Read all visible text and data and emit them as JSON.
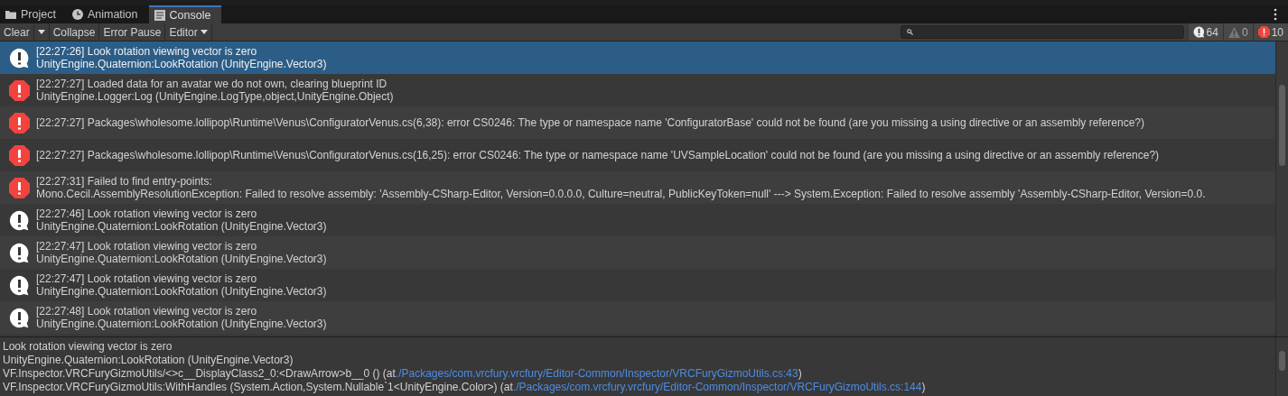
{
  "tabs": [
    {
      "label": "Project",
      "selected": false
    },
    {
      "label": "Animation",
      "selected": false
    },
    {
      "label": "Console",
      "selected": true
    }
  ],
  "toolbar": {
    "clear": "Clear",
    "collapse": "Collapse",
    "error_pause": "Error Pause",
    "editor": "Editor"
  },
  "counts": [
    {
      "kind": "log",
      "count": "64"
    },
    {
      "kind": "warning",
      "count": "0"
    },
    {
      "kind": "error",
      "count": "10"
    }
  ],
  "entries": [
    {
      "kind": "log",
      "selected": true,
      "lines": [
        "[22:27:26] Look rotation viewing vector is zero",
        "UnityEngine.Quaternion:LookRotation (UnityEngine.Vector3)"
      ]
    },
    {
      "kind": "error",
      "selected": false,
      "lines": [
        "[22:27:27] Loaded data for an avatar we do not own, clearing blueprint ID",
        "UnityEngine.Logger:Log (UnityEngine.LogType,object,UnityEngine.Object)"
      ]
    },
    {
      "kind": "error",
      "selected": false,
      "lines": [
        "[22:27:27] Packages\\wholesome.lollipop\\Runtime\\Venus\\ConfiguratorVenus.cs(6,38): error CS0246: The type or namespace name 'ConfiguratorBase' could not be found (are you missing a using directive or an assembly reference?)"
      ]
    },
    {
      "kind": "error",
      "selected": false,
      "lines": [
        "[22:27:27] Packages\\wholesome.lollipop\\Runtime\\Venus\\ConfiguratorVenus.cs(16,25): error CS0246: The type or namespace name 'UVSampleLocation' could not be found (are you missing a using directive or an assembly reference?)"
      ]
    },
    {
      "kind": "error",
      "selected": false,
      "lines": [
        "[22:27:31] Failed to find entry-points:",
        "Mono.Cecil.AssemblyResolutionException: Failed to resolve assembly: 'Assembly-CSharp-Editor, Version=0.0.0.0, Culture=neutral, PublicKeyToken=null' ---> System.Exception: Failed to resolve assembly 'Assembly-CSharp-Editor, Version=0.0."
      ]
    },
    {
      "kind": "log",
      "selected": false,
      "lines": [
        "[22:27:46] Look rotation viewing vector is zero",
        "UnityEngine.Quaternion:LookRotation (UnityEngine.Vector3)"
      ]
    },
    {
      "kind": "log",
      "selected": false,
      "lines": [
        "[22:27:47] Look rotation viewing vector is zero",
        "UnityEngine.Quaternion:LookRotation (UnityEngine.Vector3)"
      ]
    },
    {
      "kind": "log",
      "selected": false,
      "lines": [
        "[22:27:47] Look rotation viewing vector is zero",
        "UnityEngine.Quaternion:LookRotation (UnityEngine.Vector3)"
      ]
    },
    {
      "kind": "log",
      "selected": false,
      "lines": [
        "[22:27:48] Look rotation viewing vector is zero",
        "UnityEngine.Quaternion:LookRotation (UnityEngine.Vector3)"
      ]
    }
  ],
  "detail": [
    {
      "text": "Look rotation viewing vector is zero"
    },
    {
      "text": "UnityEngine.Quaternion:LookRotation (UnityEngine.Vector3)"
    },
    {
      "text": "VF.Inspector.VRCFuryGizmoUtils/<>c__DisplayClass2_0:<DrawArrow>b__0 () (at",
      "link": "./Packages/com.vrcfury.vrcfury/Editor-Common/Inspector/VRCFuryGizmoUtils.cs:43",
      "after": ")"
    },
    {
      "text": "VF.Inspector.VRCFuryGizmoUtils:WithHandles (System.Action,System.Nullable`1<UnityEngine.Color>) (at",
      "link": "./Packages/com.vrcfury.vrcfury/Editor-Common/Inspector/VRCFuryGizmoUtils.cs:144",
      "after": ")"
    }
  ]
}
